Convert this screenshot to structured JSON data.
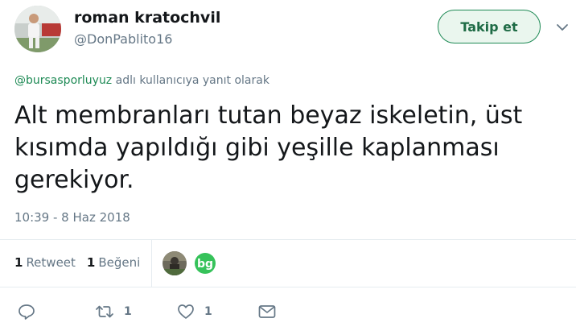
{
  "author": {
    "display_name": "roman kratochvil",
    "screen_name": "@DonPablito16"
  },
  "follow_button": {
    "label": "Takip et"
  },
  "reply_context": {
    "mention": "@bursasporluyuz",
    "suffix": "adlı kullanıcıya yanıt olarak"
  },
  "tweet": {
    "text_lines": [
      "Alt membranları tutan beyaz iskeletin, üst",
      "kısımda yapıldığı gibi yeşille kaplanması",
      "gerekiyor."
    ],
    "timestamp": "10:39 - 8 Haz 2018"
  },
  "stats": {
    "retweets": {
      "count": "1",
      "label": "Retweet"
    },
    "likes": {
      "count": "1",
      "label": "Beğeni"
    }
  },
  "liker_avatars": [
    "liker-avatar-photo",
    "liker-avatar-bg-logo"
  ],
  "actions": {
    "reply": {
      "icon": "reply-icon",
      "count": ""
    },
    "retweet": {
      "icon": "retweet-icon",
      "count": "1"
    },
    "like": {
      "icon": "heart-icon",
      "count": "1"
    },
    "message": {
      "icon": "envelope-icon",
      "count": ""
    }
  },
  "colors": {
    "accent_green": "#1e8a55",
    "follow_bg": "#eaf6ee",
    "muted_text": "#657786",
    "divider": "#e6ecf0"
  }
}
